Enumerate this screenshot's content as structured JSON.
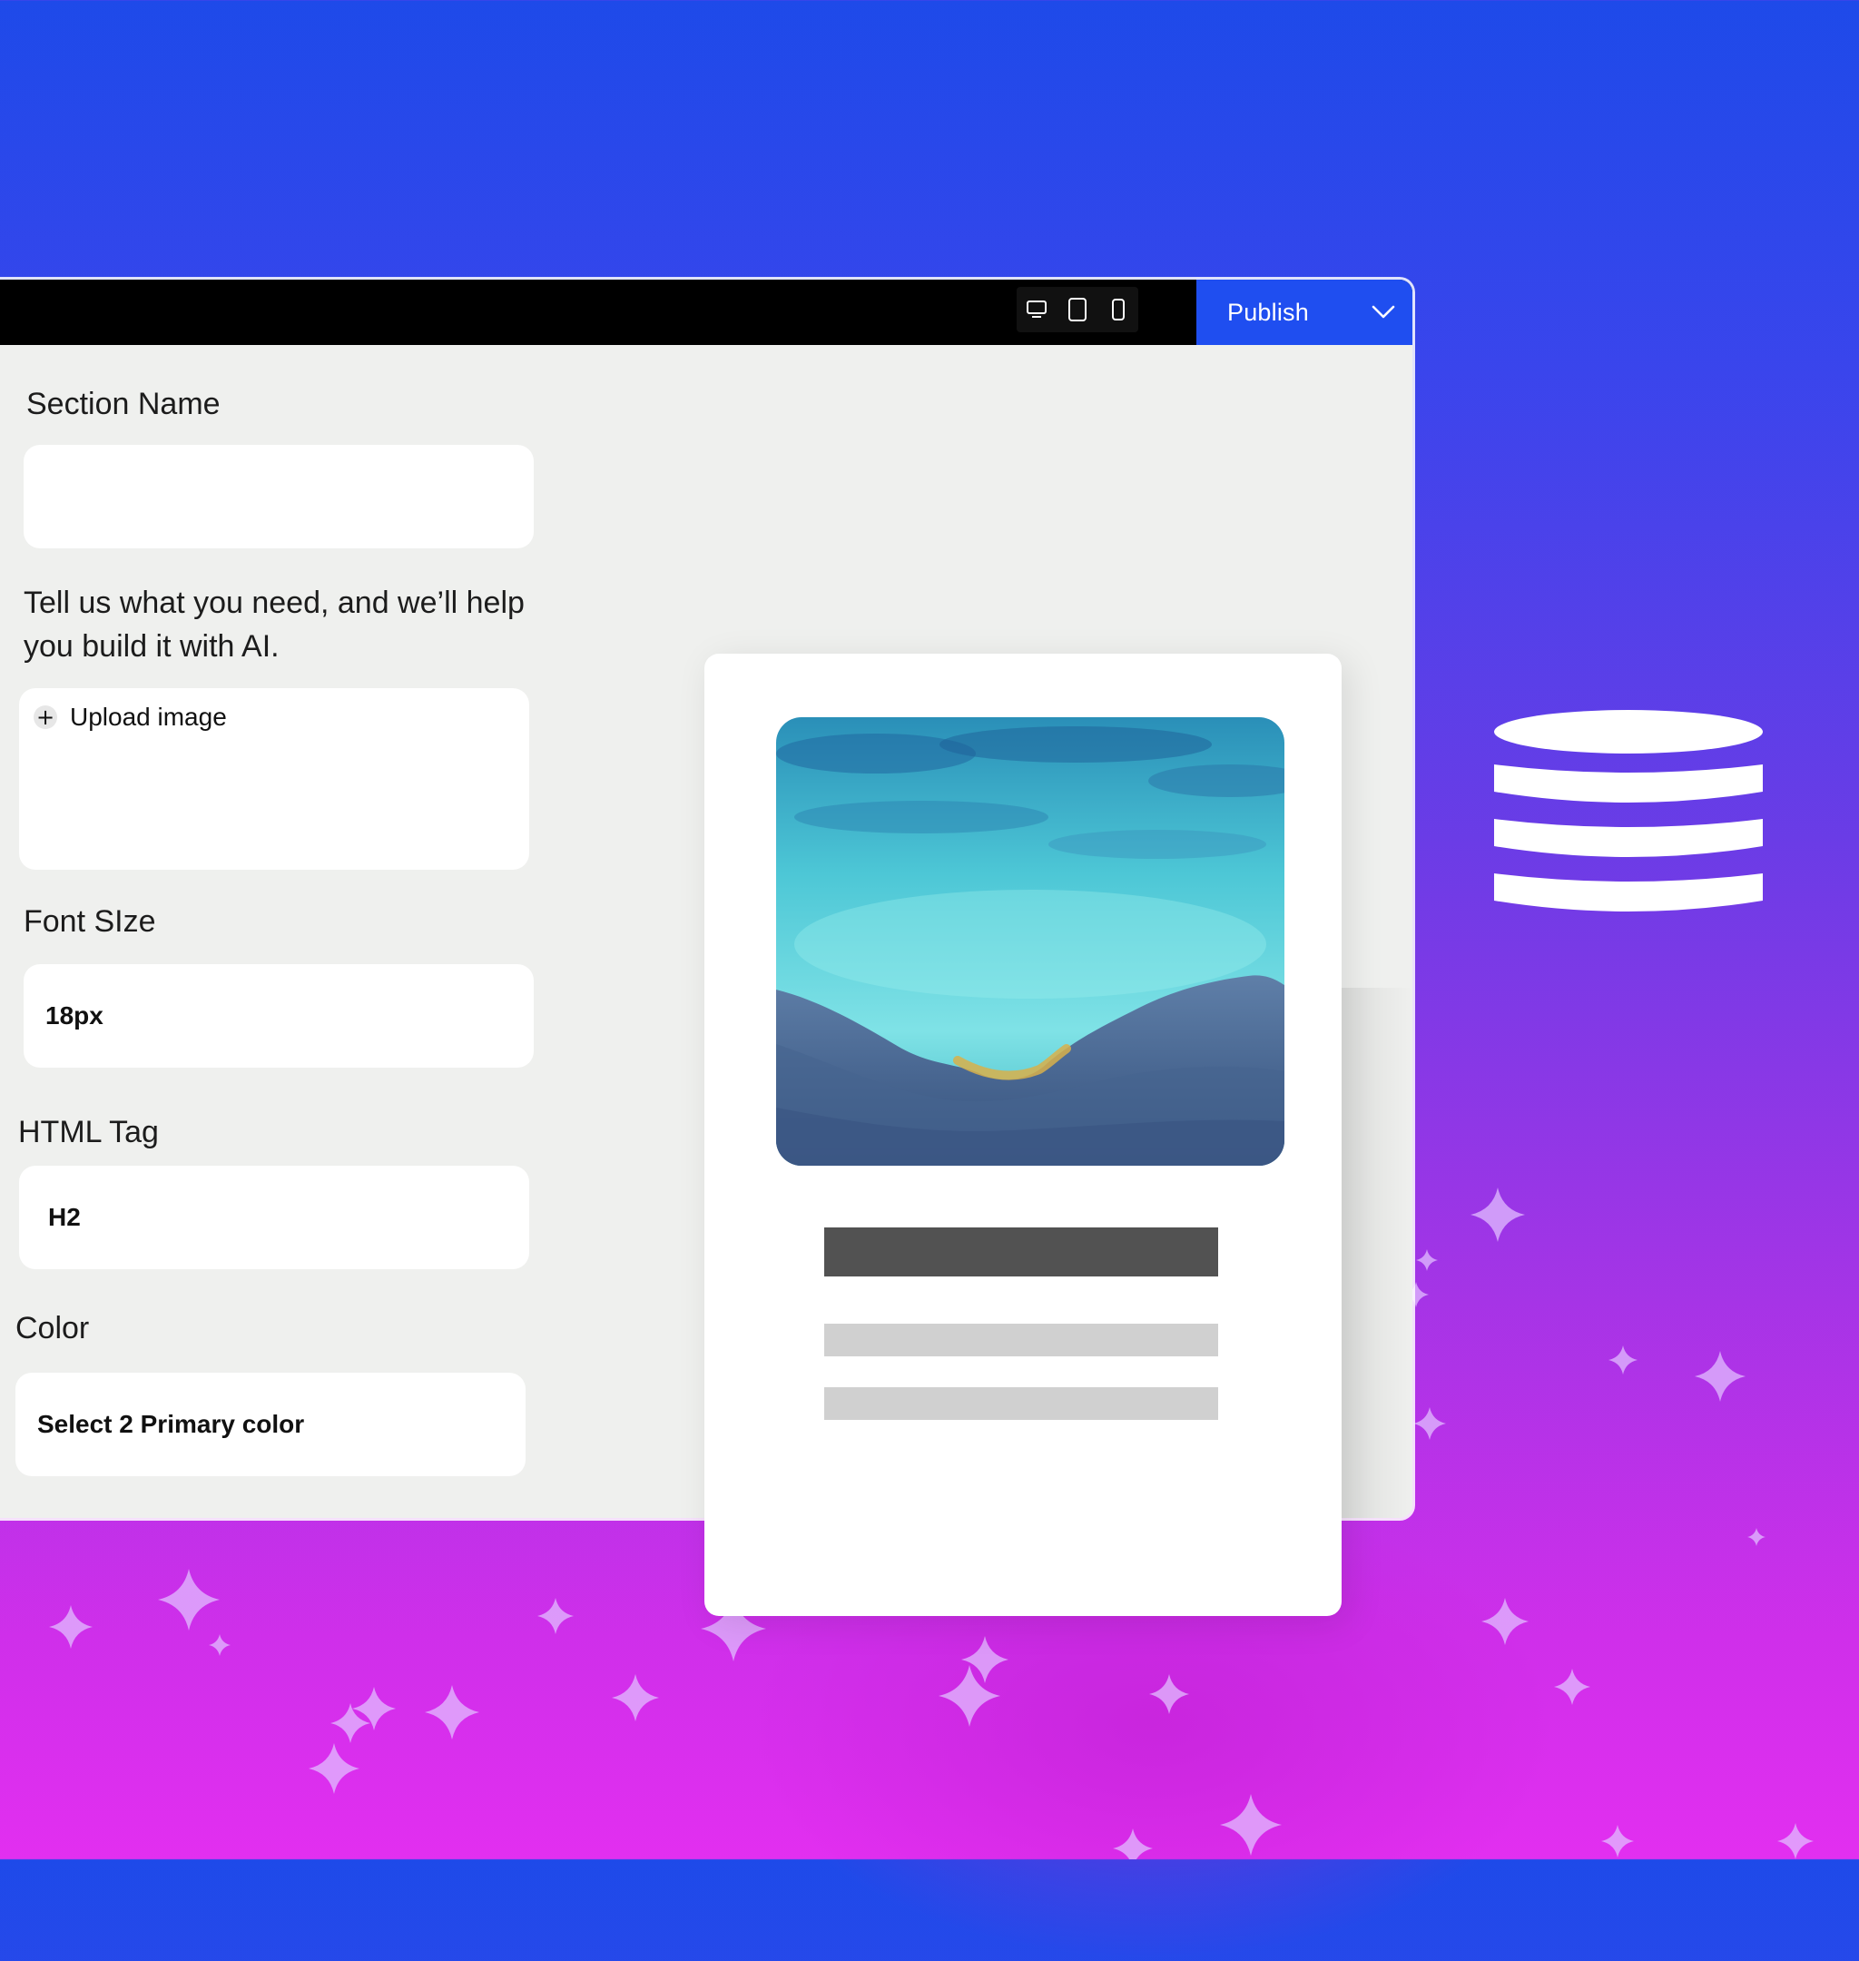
{
  "toolbar": {
    "device_icons": [
      "desktop-icon",
      "tablet-icon",
      "mobile-icon"
    ],
    "publish_label": "Publish",
    "publish_color": "#1f4ef0"
  },
  "form": {
    "section_name": {
      "label": "Section Name",
      "value": ""
    },
    "prompt": {
      "text": "Tell us what you need, and we’ll help you build it with AI.",
      "upload_label": "Upload image"
    },
    "font_size": {
      "label": "Font SIze",
      "value": "18px"
    },
    "html_tag": {
      "label": "HTML Tag",
      "value": "H2"
    },
    "color": {
      "label": "Color",
      "value": "Select 2 Primary color"
    }
  },
  "decor": {
    "database_icon": "database-icon",
    "sparkle_icon": "sparkle-icon"
  }
}
